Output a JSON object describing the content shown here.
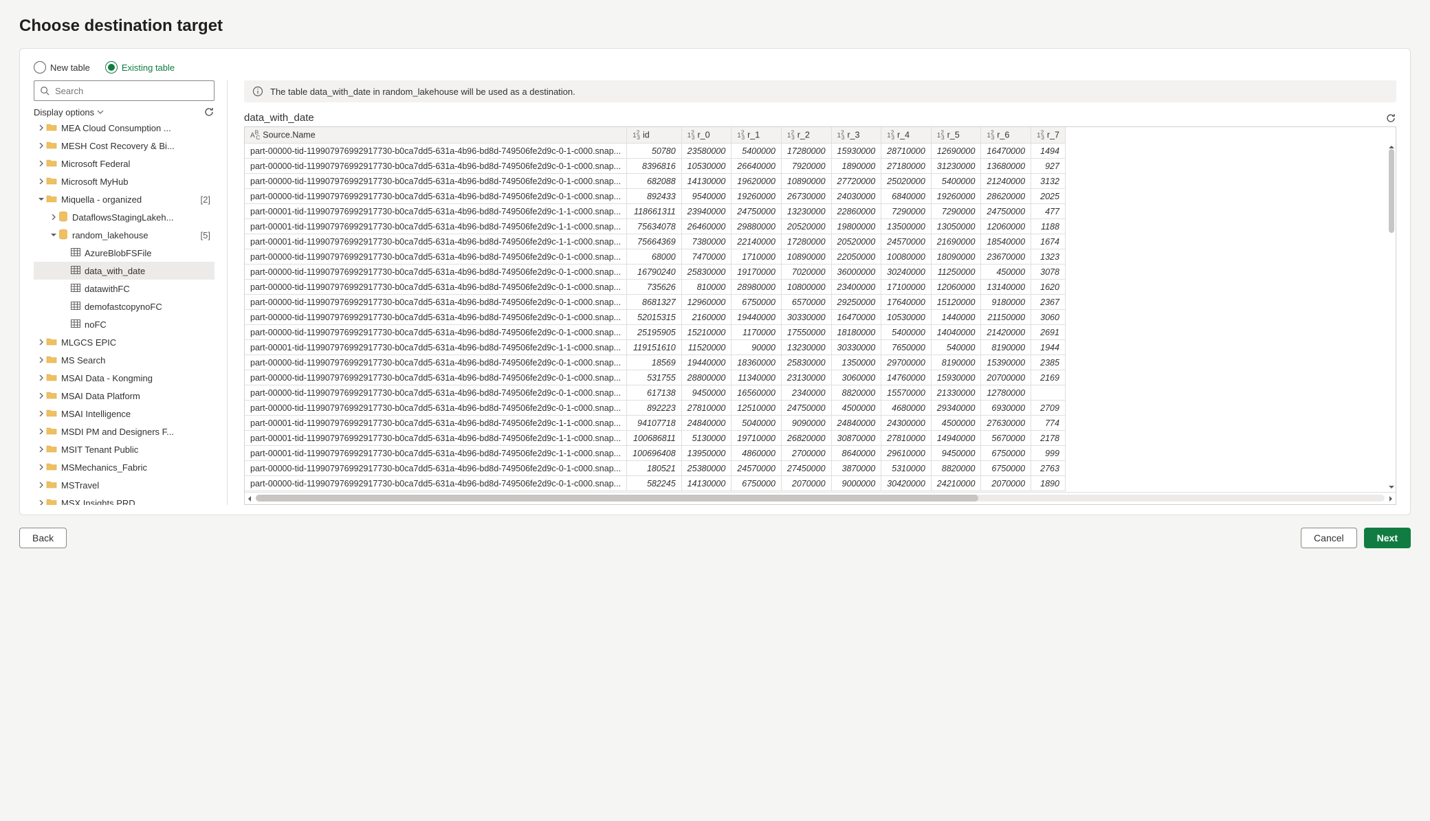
{
  "page_title": "Choose destination target",
  "radios": {
    "new_table": "New table",
    "existing_table": "Existing table"
  },
  "search_placeholder": "Search",
  "display_options_label": "Display options",
  "info_message": "The table data_with_date in random_lakehouse will be used as a destination.",
  "table_name": "data_with_date",
  "footer": {
    "back": "Back",
    "cancel": "Cancel",
    "next": "Next"
  },
  "tree": [
    {
      "level": 1,
      "caret": "right",
      "icon": "folder",
      "label": "MEA Cloud Consumption ..."
    },
    {
      "level": 1,
      "caret": "right",
      "icon": "folder",
      "label": "MESH Cost Recovery & Bi..."
    },
    {
      "level": 1,
      "caret": "right",
      "icon": "folder",
      "label": "Microsoft Federal"
    },
    {
      "level": 1,
      "caret": "right",
      "icon": "folder",
      "label": "Microsoft MyHub"
    },
    {
      "level": 1,
      "caret": "down",
      "icon": "folder",
      "label": "Miquella - organized",
      "count": "[2]"
    },
    {
      "level": 2,
      "caret": "right",
      "icon": "db",
      "label": "DataflowsStagingLakeh..."
    },
    {
      "level": 2,
      "caret": "down",
      "icon": "db",
      "label": "random_lakehouse",
      "count": "[5]"
    },
    {
      "level": 3,
      "caret": "blank",
      "icon": "table",
      "label": "AzureBlobFSFile"
    },
    {
      "level": 3,
      "caret": "blank",
      "icon": "table",
      "label": "data_with_date",
      "selected": true
    },
    {
      "level": 3,
      "caret": "blank",
      "icon": "table",
      "label": "datawithFC"
    },
    {
      "level": 3,
      "caret": "blank",
      "icon": "table",
      "label": "demofastcopynoFC"
    },
    {
      "level": 3,
      "caret": "blank",
      "icon": "table",
      "label": "noFC"
    },
    {
      "level": 1,
      "caret": "right",
      "icon": "folder",
      "label": "MLGCS EPIC"
    },
    {
      "level": 1,
      "caret": "right",
      "icon": "folder",
      "label": "MS Search"
    },
    {
      "level": 1,
      "caret": "right",
      "icon": "folder",
      "label": "MSAI Data - Kongming"
    },
    {
      "level": 1,
      "caret": "right",
      "icon": "folder",
      "label": "MSAI Data Platform"
    },
    {
      "level": 1,
      "caret": "right",
      "icon": "folder",
      "label": "MSAI Intelligence"
    },
    {
      "level": 1,
      "caret": "right",
      "icon": "folder",
      "label": "MSDI PM and Designers F..."
    },
    {
      "level": 1,
      "caret": "right",
      "icon": "folder",
      "label": "MSIT Tenant Public"
    },
    {
      "level": 1,
      "caret": "right",
      "icon": "folder",
      "label": "MSMechanics_Fabric"
    },
    {
      "level": 1,
      "caret": "right",
      "icon": "folder",
      "label": "MSTravel"
    },
    {
      "level": 1,
      "caret": "right",
      "icon": "folder",
      "label": "MSX Insights PRD"
    }
  ],
  "columns": [
    {
      "type": "ABC",
      "name": "Source.Name",
      "cls": "col-source",
      "tcls": "txt"
    },
    {
      "type": "123",
      "name": "id",
      "cls": "col-id",
      "tcls": "num"
    },
    {
      "type": "123",
      "name": "r_0",
      "cls": "col-r",
      "tcls": "num"
    },
    {
      "type": "123",
      "name": "r_1",
      "cls": "col-r",
      "tcls": "num"
    },
    {
      "type": "123",
      "name": "r_2",
      "cls": "col-r",
      "tcls": "num"
    },
    {
      "type": "123",
      "name": "r_3",
      "cls": "col-r",
      "tcls": "num"
    },
    {
      "type": "123",
      "name": "r_4",
      "cls": "col-r",
      "tcls": "num"
    },
    {
      "type": "123",
      "name": "r_5",
      "cls": "col-r",
      "tcls": "num"
    },
    {
      "type": "123",
      "name": "r_6",
      "cls": "col-r",
      "tcls": "num"
    },
    {
      "type": "123",
      "name": "r_7",
      "cls": "col-r7",
      "tcls": "num"
    }
  ],
  "rows": [
    [
      "part-00000-tid-1199079769929​17730-b0ca7dd5-631a-4b96-bd8d-749506fe2d9c-0-1-c000.snap...",
      "50780",
      "23580000",
      "5400000",
      "17280000",
      "15930000",
      "28710000",
      "12690000",
      "16470000",
      "1494"
    ],
    [
      "part-00000-tid-1199079769929​17730-b0ca7dd5-631a-4b96-bd8d-749506fe2d9c-0-1-c000.snap...",
      "8396816",
      "10530000",
      "26640000",
      "7920000",
      "1890000",
      "27180000",
      "31230000",
      "13680000",
      "927"
    ],
    [
      "part-00000-tid-1199079769929​17730-b0ca7dd5-631a-4b96-bd8d-749506fe2d9c-0-1-c000.snap...",
      "682088",
      "14130000",
      "19620000",
      "10890000",
      "27720000",
      "25020000",
      "5400000",
      "21240000",
      "3132"
    ],
    [
      "part-00000-tid-1199079769929​17730-b0ca7dd5-631a-4b96-bd8d-749506fe2d9c-0-1-c000.snap...",
      "892433",
      "9540000",
      "19260000",
      "26730000",
      "24030000",
      "6840000",
      "19260000",
      "28620000",
      "2025"
    ],
    [
      "part-00001-tid-1199079769929​17730-b0ca7dd5-631a-4b96-bd8d-749506fe2d9c-1-1-c000.snap...",
      "118661311",
      "23940000",
      "24750000",
      "13230000",
      "22860000",
      "7290000",
      "7290000",
      "24750000",
      "477"
    ],
    [
      "part-00001-tid-1199079769929​17730-b0ca7dd5-631a-4b96-bd8d-749506fe2d9c-1-1-c000.snap...",
      "75634078",
      "26460000",
      "29880000",
      "20520000",
      "19800000",
      "13500000",
      "13050000",
      "12060000",
      "1188"
    ],
    [
      "part-00001-tid-1199079769929​17730-b0ca7dd5-631a-4b96-bd8d-749506fe2d9c-1-1-c000.snap...",
      "75664369",
      "7380000",
      "22140000",
      "17280000",
      "20520000",
      "24570000",
      "21690000",
      "18540000",
      "1674"
    ],
    [
      "part-00000-tid-1199079769929​17730-b0ca7dd5-631a-4b96-bd8d-749506fe2d9c-0-1-c000.snap...",
      "68000",
      "7470000",
      "1710000",
      "10890000",
      "22050000",
      "10080000",
      "18090000",
      "23670000",
      "1323"
    ],
    [
      "part-00000-tid-1199079769929​17730-b0ca7dd5-631a-4b96-bd8d-749506fe2d9c-0-1-c000.snap...",
      "16790240",
      "25830000",
      "19170000",
      "7020000",
      "36000000",
      "30240000",
      "11250000",
      "450000",
      "3078"
    ],
    [
      "part-00000-tid-1199079769929​17730-b0ca7dd5-631a-4b96-bd8d-749506fe2d9c-0-1-c000.snap...",
      "735626",
      "810000",
      "28980000",
      "10800000",
      "23400000",
      "17100000",
      "12060000",
      "13140000",
      "1620"
    ],
    [
      "part-00000-tid-1199079769929​17730-b0ca7dd5-631a-4b96-bd8d-749506fe2d9c-0-1-c000.snap...",
      "8681327",
      "12960000",
      "6750000",
      "6570000",
      "29250000",
      "17640000",
      "15120000",
      "9180000",
      "2367"
    ],
    [
      "part-00000-tid-1199079769929​17730-b0ca7dd5-631a-4b96-bd8d-749506fe2d9c-0-1-c000.snap...",
      "52015315",
      "2160000",
      "19440000",
      "30330000",
      "16470000",
      "10530000",
      "1440000",
      "21150000",
      "3060"
    ],
    [
      "part-00000-tid-1199079769929​17730-b0ca7dd5-631a-4b96-bd8d-749506fe2d9c-0-1-c000.snap...",
      "25195905",
      "15210000",
      "1170000",
      "17550000",
      "18180000",
      "5400000",
      "14040000",
      "21420000",
      "2691"
    ],
    [
      "part-00001-tid-1199079769929​17730-b0ca7dd5-631a-4b96-bd8d-749506fe2d9c-1-1-c000.snap...",
      "119151610",
      "11520000",
      "90000",
      "13230000",
      "30330000",
      "7650000",
      "540000",
      "8190000",
      "1944"
    ],
    [
      "part-00000-tid-1199079769929​17730-b0ca7dd5-631a-4b96-bd8d-749506fe2d9c-0-1-c000.snap...",
      "18569",
      "19440000",
      "18360000",
      "25830000",
      "1350000",
      "29700000",
      "8190000",
      "15390000",
      "2385"
    ],
    [
      "part-00000-tid-1199079769929​17730-b0ca7dd5-631a-4b96-bd8d-749506fe2d9c-0-1-c000.snap...",
      "531755",
      "28800000",
      "11340000",
      "23130000",
      "3060000",
      "14760000",
      "15930000",
      "20700000",
      "2169"
    ],
    [
      "part-00000-tid-1199079769929​17730-b0ca7dd5-631a-4b96-bd8d-749506fe2d9c-0-1-c000.snap...",
      "617138",
      "9450000",
      "16560000",
      "2340000",
      "8820000",
      "15570000",
      "21330000",
      "12780000",
      ""
    ],
    [
      "part-00000-tid-1199079769929​17730-b0ca7dd5-631a-4b96-bd8d-749506fe2d9c-0-1-c000.snap...",
      "892223",
      "27810000",
      "12510000",
      "24750000",
      "4500000",
      "4680000",
      "29340000",
      "6930000",
      "2709"
    ],
    [
      "part-00001-tid-1199079769929​17730-b0ca7dd5-631a-4b96-bd8d-749506fe2d9c-1-1-c000.snap...",
      "94107718",
      "24840000",
      "5040000",
      "9090000",
      "24840000",
      "24300000",
      "4500000",
      "27630000",
      "774"
    ],
    [
      "part-00001-tid-1199079769929​17730-b0ca7dd5-631a-4b96-bd8d-749506fe2d9c-1-1-c000.snap...",
      "100686811",
      "5130000",
      "19710000",
      "26820000",
      "30870000",
      "27810000",
      "14940000",
      "5670000",
      "2178"
    ],
    [
      "part-00001-tid-1199079769929​17730-b0ca7dd5-631a-4b96-bd8d-749506fe2d9c-1-1-c000.snap...",
      "100696408",
      "13950000",
      "4860000",
      "2700000",
      "8640000",
      "29610000",
      "9450000",
      "6750000",
      "999"
    ],
    [
      "part-00000-tid-1199079769929​17730-b0ca7dd5-631a-4b96-bd8d-749506fe2d9c-0-1-c000.snap...",
      "180521",
      "25380000",
      "24570000",
      "27450000",
      "3870000",
      "5310000",
      "8820000",
      "6750000",
      "2763"
    ],
    [
      "part-00000-tid-1199079769929​17730-b0ca7dd5-631a-4b96-bd8d-749506fe2d9c-0-1-c000.snap...",
      "582245",
      "14130000",
      "6750000",
      "2070000",
      "9000000",
      "30420000",
      "24210000",
      "2070000",
      "1890"
    ]
  ]
}
